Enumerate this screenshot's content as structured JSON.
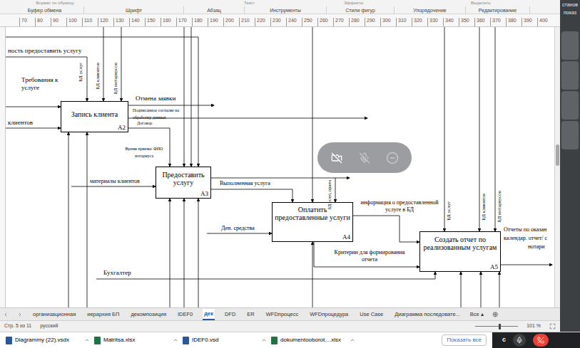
{
  "ribbon": {
    "top_items": [
      "Формат по образцу",
      "Текст",
      "Эффекты",
      "Выделить"
    ],
    "groups": [
      "Буфер обмена",
      "Шрифт",
      "Абзац",
      "Инструменты",
      "Стили фигур",
      "Упорядочение",
      "Редактирование"
    ]
  },
  "ruler": {
    "ticks": [
      "70",
      "80",
      "90",
      "100",
      "110",
      "120",
      "130",
      "140",
      "150",
      "160",
      "170",
      "180",
      "190",
      "200",
      "210",
      "220",
      "230",
      "240",
      "250",
      "260",
      "270",
      "280",
      "290",
      "300",
      "310",
      "320",
      "330",
      "340",
      "350",
      "360",
      "370",
      "380",
      "390",
      "400"
    ]
  },
  "diagram": {
    "boxes": [
      {
        "label": "Запись клиента",
        "number": "A2"
      },
      {
        "label": "Предоставить услугу",
        "number": "A3"
      },
      {
        "label": "Оплатить предоставленные услуги",
        "number": "A4"
      },
      {
        "label": "Создать отчет по реализованным услугам",
        "number": "A5"
      }
    ],
    "labels": [
      {
        "text": "ность предоставить услугу",
        "kind": "horizontal"
      },
      {
        "text": "Требования к услуге",
        "kind": "horizontal"
      },
      {
        "text": "БД услуг",
        "kind": "vertical"
      },
      {
        "text": "БД клиентов",
        "kind": "vertical"
      },
      {
        "text": "БД нотариусов",
        "kind": "vertical"
      },
      {
        "text": "Отмена заявки",
        "kind": "horizontal"
      },
      {
        "text": "Подписанное согласие на обработку данных",
        "kind": "horizontal"
      },
      {
        "text": "Договор",
        "kind": "horizontal"
      },
      {
        "text": "Время приема/ ФИО нотариуса",
        "kind": "horizontal"
      },
      {
        "text": "клиентов",
        "kind": "horizontal"
      },
      {
        "text": "материалы клиентов",
        "kind": "horizontal"
      },
      {
        "text": "Выполненная услуга",
        "kind": "horizontal"
      },
      {
        "text": "БД услуг, прием",
        "kind": "vertical"
      },
      {
        "text": "информация о предоставленной услуге в БД",
        "kind": "horizontal"
      },
      {
        "text": "Ден. средства",
        "kind": "horizontal"
      },
      {
        "text": "БД услуг",
        "kind": "vertical"
      },
      {
        "text": "БД клиентов",
        "kind": "vertical"
      },
      {
        "text": "БД нотариусов",
        "kind": "vertical"
      },
      {
        "text": "Отчеты по оказан",
        "kind": "horizontal"
      },
      {
        "text": "календар. отчет/ с",
        "kind": "horizontal"
      },
      {
        "text": "нотари",
        "kind": "horizontal"
      },
      {
        "text": "Критерии для формирования отчета",
        "kind": "horizontal"
      },
      {
        "text": "Бухгалтер",
        "kind": "horizontal"
      }
    ]
  },
  "call_overlay": {
    "video_off": true,
    "mic_off": true
  },
  "sheet_tabs": [
    {
      "label": "организационная",
      "selected": false
    },
    {
      "label": "иерархия БП",
      "selected": false
    },
    {
      "label": "декомпозиция",
      "selected": false
    },
    {
      "label": "IDEF0",
      "selected": false
    },
    {
      "label": "дек",
      "selected": true
    },
    {
      "label": "DFD",
      "selected": false
    },
    {
      "label": "ER",
      "selected": false
    },
    {
      "label": "WFDпроцесс",
      "selected": false
    },
    {
      "label": "WFDпроцедура",
      "selected": false
    },
    {
      "label": "Use Case",
      "selected": false
    },
    {
      "label": "Диаграмма последовате...",
      "selected": false
    }
  ],
  "tabs_more": "Все ▴",
  "add_tab": "⊕",
  "status_bar": {
    "page": "Стр. 5 из 11",
    "language": "русский",
    "zoom": "101 %",
    "zoom_level": 0.55
  },
  "downloads": [
    {
      "name": "Diagrammy (22).vsdx",
      "color": "#2b579a"
    },
    {
      "name": "Matritsa.xlsx",
      "color": "#217346"
    },
    {
      "name": "IDEF0.vsd",
      "color": "#2b579a"
    },
    {
      "name": "dokumentooborot....xlsx",
      "color": "#217346"
    }
  ],
  "show_all": "Показать все",
  "call_controls": {
    "label": "с",
    "mic_on": true
  },
  "side_panel": {
    "texts": [
      "станов",
      "показ"
    ]
  }
}
